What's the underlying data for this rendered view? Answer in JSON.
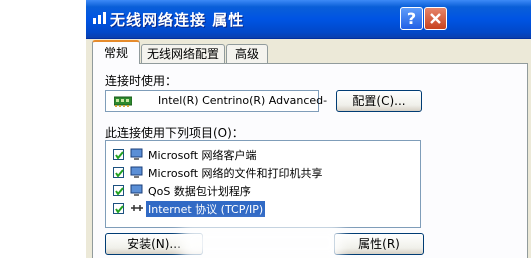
{
  "window": {
    "title": "无线网络连接 属性",
    "help_label": "?"
  },
  "tabs": [
    {
      "label": "常规",
      "active": true
    },
    {
      "label": "无线网络配置",
      "active": false
    },
    {
      "label": "高级",
      "active": false
    }
  ],
  "connect_using": {
    "label": "连接时使用：",
    "adapter_name": "Intel(R) Centrino(R) Advanced-",
    "configure_button": "配置(C)..."
  },
  "items_section": {
    "label": "此连接使用下列项目(O)：",
    "items": [
      {
        "label": "Microsoft 网络客户端",
        "checked": true,
        "icon": "network-client-icon",
        "selected": false
      },
      {
        "label": "Microsoft 网络的文件和打印机共享",
        "checked": true,
        "icon": "file-printer-sharing-icon",
        "selected": false
      },
      {
        "label": "QoS 数据包计划程序",
        "checked": true,
        "icon": "qos-scheduler-icon",
        "selected": false
      },
      {
        "label": "Internet 协议 (TCP/IP)",
        "checked": true,
        "icon": "protocol-icon",
        "selected": true
      }
    ]
  },
  "buttons": {
    "install": "安装(N)...",
    "properties": "属性(R)"
  }
}
